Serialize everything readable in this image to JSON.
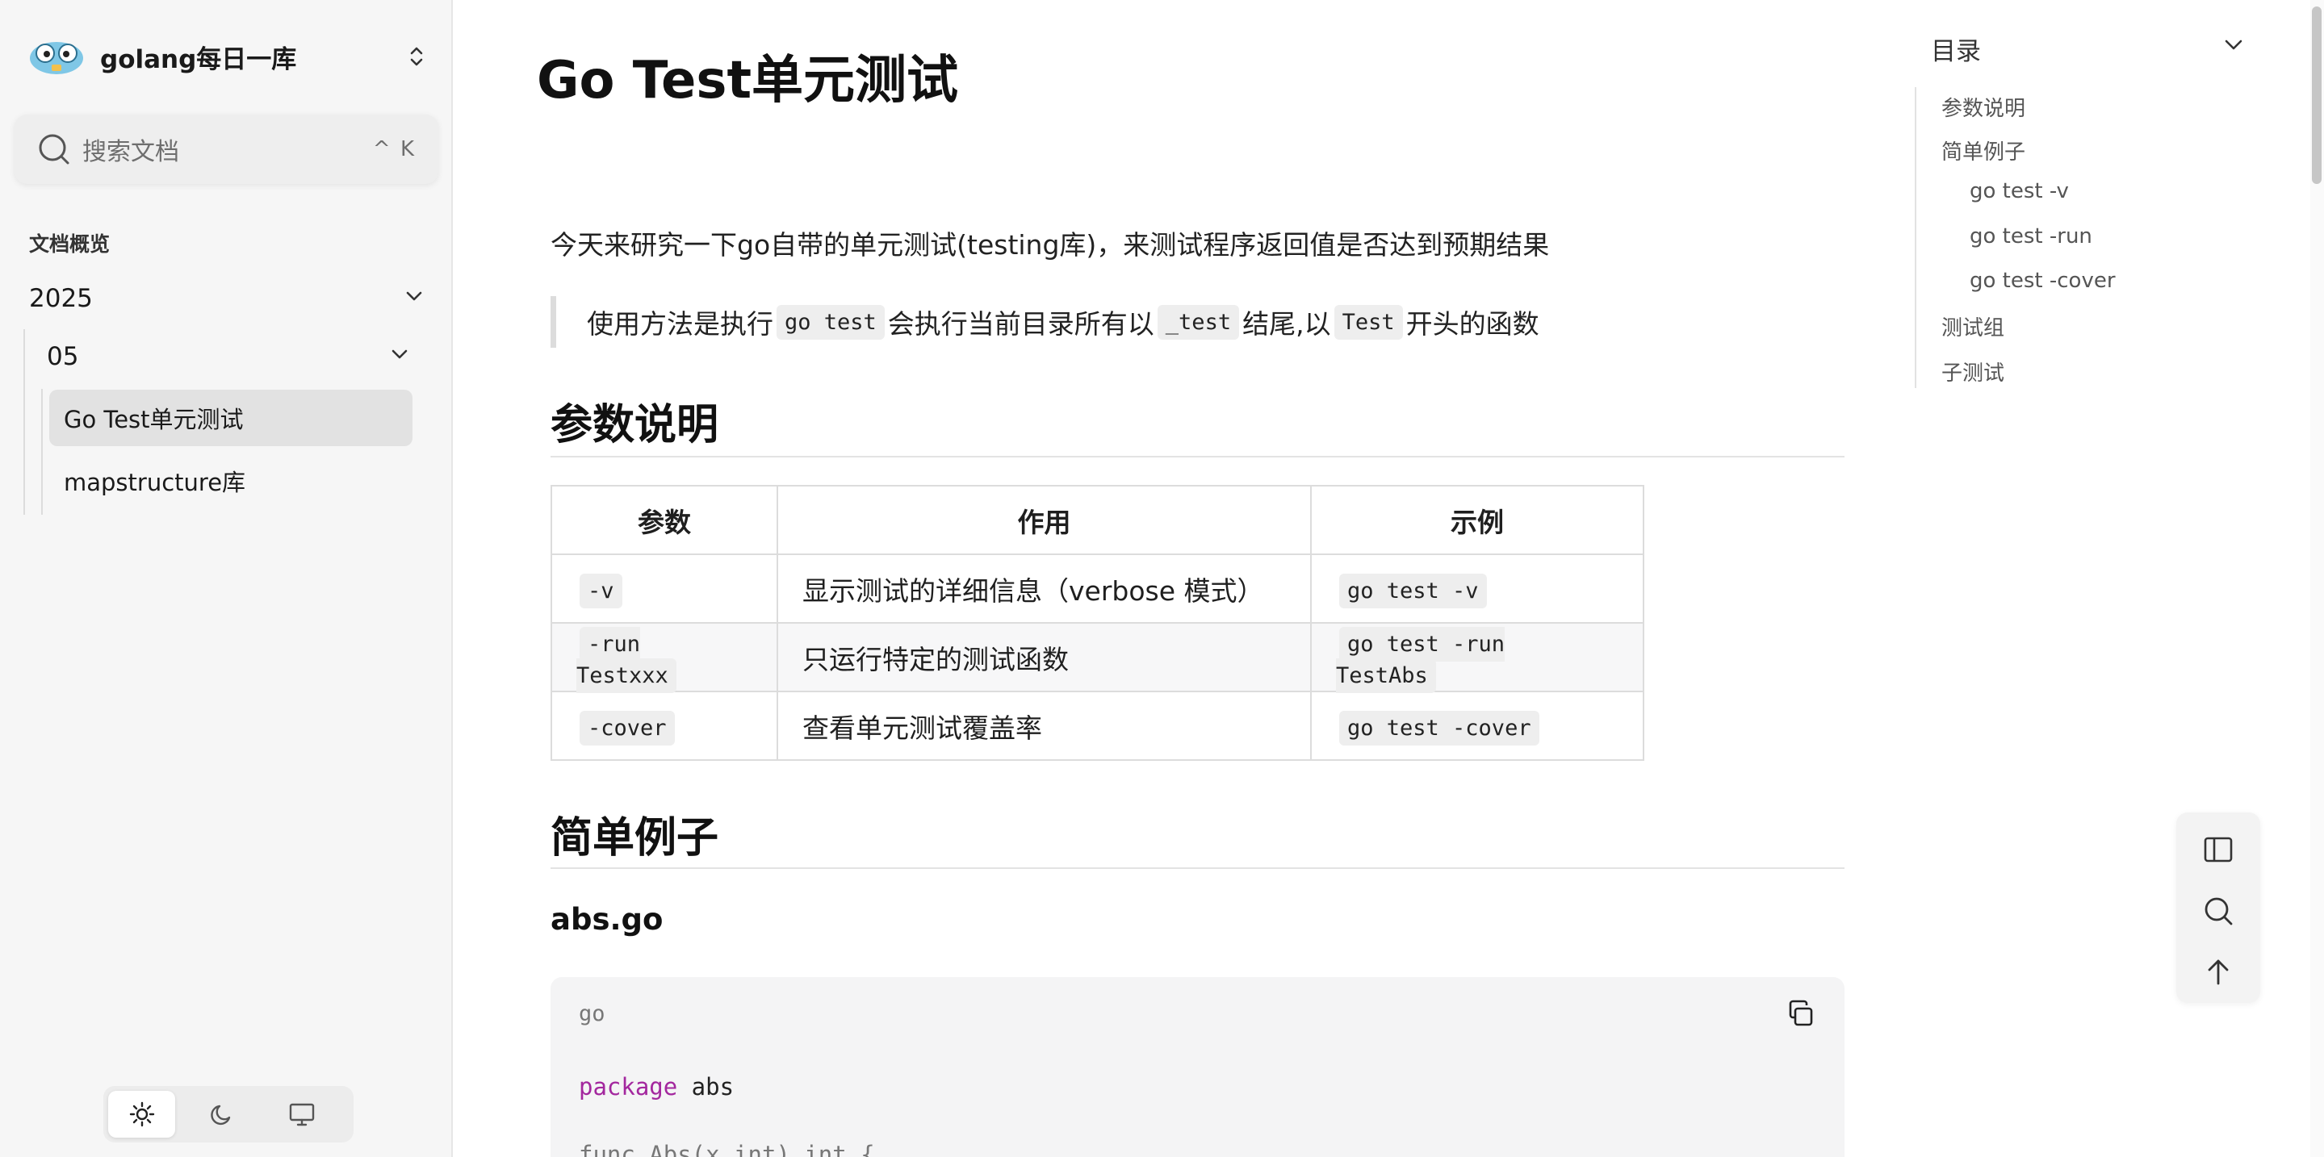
{
  "brand": {
    "title": "golang每日一库",
    "logo_icon": "gopher-logo-icon"
  },
  "search": {
    "placeholder": "搜索文档",
    "shortcut": "^ K"
  },
  "sidebar": {
    "overview": "文档概览",
    "year": "2025",
    "month": "05",
    "items": [
      {
        "label": "Go Test单元测试",
        "active": true
      },
      {
        "label": "mapstructure库",
        "active": false
      }
    ]
  },
  "theme": {
    "options": [
      "light",
      "dark",
      "system"
    ],
    "selected": "light"
  },
  "article": {
    "title": "Go Test单元测试",
    "intro": "今天来研究一下go自带的单元测试(testing库)，来测试程序返回值是否达到预期结果",
    "quote": {
      "t1": "使用方法是执行",
      "c1": "go test",
      "t2": "会执行当前目录所有以",
      "c2": "_test",
      "t3": "结尾,以",
      "c3": "Test",
      "t4": "开头的函数"
    },
    "section1": "参数说明",
    "table": {
      "headers": [
        "参数",
        "作用",
        "示例"
      ],
      "rows": [
        {
          "param": "-v",
          "desc": "显示测试的详细信息（verbose 模式）",
          "example": "go test -v"
        },
        {
          "param": "-run Testxxx",
          "desc": "只运行特定的测试函数",
          "example": "go test -run TestAbs"
        },
        {
          "param": "-cover",
          "desc": "查看单元测试覆盖率",
          "example": "go test -cover"
        }
      ]
    },
    "section2": "简单例子",
    "file_title": "abs.go",
    "code": {
      "lang": "go",
      "line1_kw": "package",
      "line1_rest": " abs",
      "line2_partial": "func Abs(x int) int {"
    }
  },
  "toc": {
    "title": "目录",
    "items": [
      {
        "label": "参数说明",
        "level": 1
      },
      {
        "label": "简单例子",
        "level": 1
      },
      {
        "label": "go test -v",
        "level": 2
      },
      {
        "label": "go test -run",
        "level": 2
      },
      {
        "label": "go test -cover",
        "level": 2
      },
      {
        "label": "测试组",
        "level": 1
      },
      {
        "label": "子测试",
        "level": 1
      }
    ]
  },
  "colors": {
    "sidebar_bg": "#f6f6f6",
    "active_item": "#e2e2e2",
    "keyword": "#a3279e",
    "code_bg": "#f4f4f5"
  }
}
